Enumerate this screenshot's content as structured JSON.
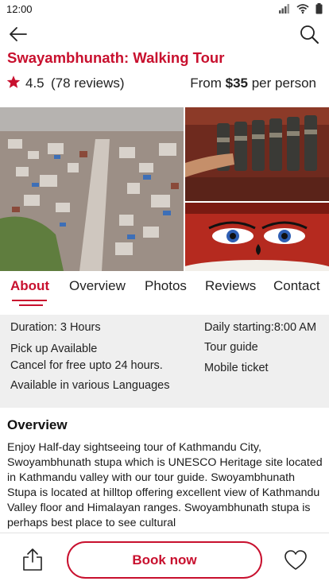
{
  "status_bar": {
    "time": "12:00",
    "icons": [
      "signal-icon",
      "wifi-icon",
      "battery-icon"
    ]
  },
  "nav": {
    "back_icon": "arrow-left-icon",
    "search_icon": "search-icon"
  },
  "tour": {
    "title": "Swayambhunath: Walking Tour",
    "rating": "4.5",
    "reviews": "(78 reviews)",
    "price_prefix": "From",
    "price": "$35",
    "price_suffix": "per person"
  },
  "gallery": {
    "images": [
      "aerial-city-photo",
      "prayer-wheels-photo",
      "buddha-eyes-stupa-photo"
    ]
  },
  "tabs": [
    {
      "label": "About",
      "active": true
    },
    {
      "label": "Overview",
      "active": false
    },
    {
      "label": "Photos",
      "active": false
    },
    {
      "label": "Reviews",
      "active": false
    },
    {
      "label": "Contact",
      "active": false
    }
  ],
  "info": {
    "duration": "Duration: 3 Hours",
    "pickup": "Pick up Available",
    "cancel": "Cancel for free upto 24 hours.",
    "languages": "Available in various Languages",
    "daily": "Daily starting:8:00 AM",
    "guide": "Tour guide",
    "ticket": "Mobile ticket"
  },
  "overview": {
    "heading": "Overview",
    "text": "Enjoy Half-day sightseeing tour of Kathmandu City, Swoyambhunath stupa which is UNESCO Heritage site located in Kathmandu valley with our tour guide. Swoyambhunath Stupa is located at hilltop offering excellent view of Kathmandu Valley floor and Himalayan ranges. Swoyambhunath stupa is perhaps best place to see cultural"
  },
  "bottom": {
    "book_label": "Book now",
    "share_icon": "share-icon",
    "favorite_icon": "heart-icon"
  },
  "colors": {
    "accent": "#c8102e",
    "panel": "#efefef"
  }
}
